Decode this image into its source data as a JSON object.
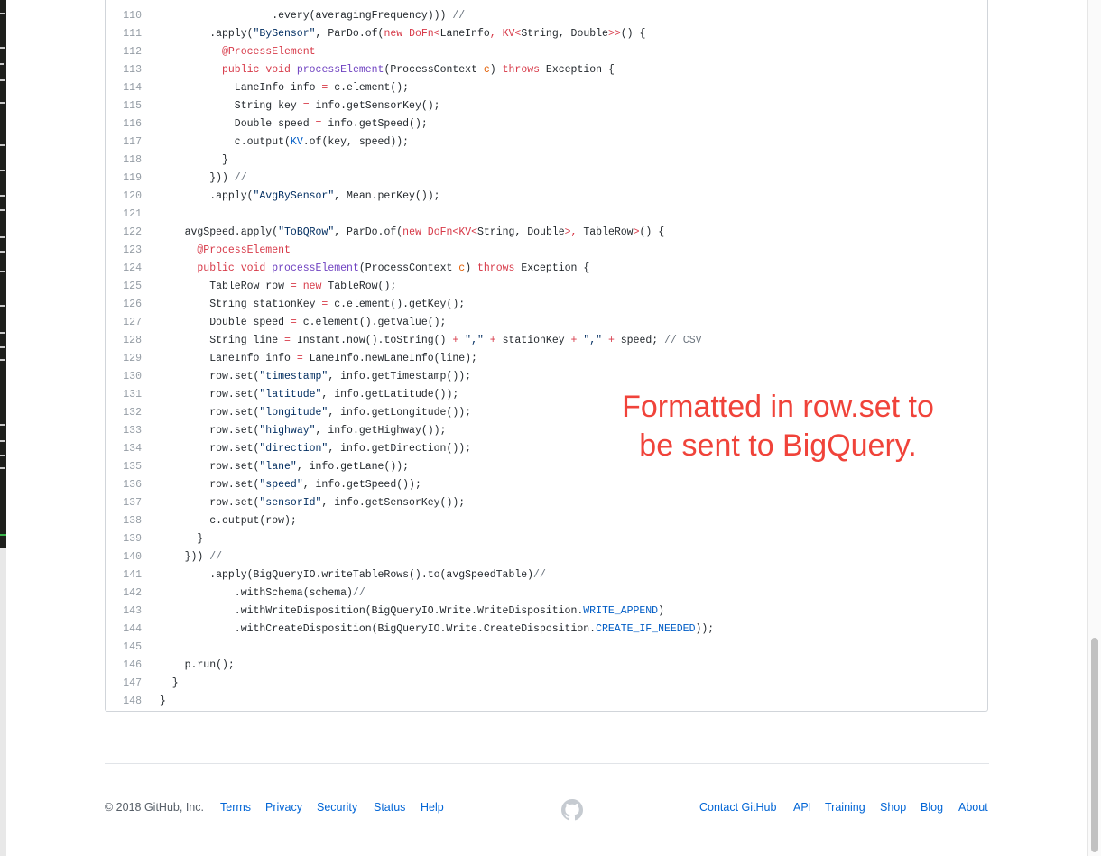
{
  "code_lines": [
    {
      "n": "110",
      "indent": 18,
      "tokens": [
        {
          "t": ".every(averagingFrequency))) "
        },
        {
          "t": "//",
          "c": "pl-c"
        }
      ]
    },
    {
      "n": "111",
      "indent": 8,
      "tokens": [
        {
          "t": ".apply("
        },
        {
          "t": "\"BySensor\"",
          "c": "pl-s"
        },
        {
          "t": ", ParDo.of("
        },
        {
          "t": "new",
          "c": "pl-k"
        },
        {
          "t": " "
        },
        {
          "t": "DoFn<",
          "c": "pl-k"
        },
        {
          "t": "LaneInfo"
        },
        {
          "t": ", ",
          "c": "pl-k"
        },
        {
          "t": "KV<",
          "c": "pl-k"
        },
        {
          "t": "String, Double"
        },
        {
          "t": ">>",
          "c": "pl-k"
        },
        {
          "t": "() {"
        }
      ]
    },
    {
      "n": "112",
      "indent": 10,
      "tokens": [
        {
          "t": "@ProcessElement",
          "c": "pl-k"
        }
      ]
    },
    {
      "n": "113",
      "indent": 10,
      "tokens": [
        {
          "t": "public",
          "c": "pl-k"
        },
        {
          "t": " "
        },
        {
          "t": "void",
          "c": "pl-k"
        },
        {
          "t": " "
        },
        {
          "t": "processElement",
          "c": "pl-en"
        },
        {
          "t": "(ProcessContext "
        },
        {
          "t": "c",
          "c": "pl-v"
        },
        {
          "t": ") "
        },
        {
          "t": "throws",
          "c": "pl-k"
        },
        {
          "t": " Exception {"
        }
      ]
    },
    {
      "n": "114",
      "indent": 12,
      "tokens": [
        {
          "t": "LaneInfo info "
        },
        {
          "t": "=",
          "c": "pl-k"
        },
        {
          "t": " c.element();"
        }
      ]
    },
    {
      "n": "115",
      "indent": 12,
      "tokens": [
        {
          "t": "String key "
        },
        {
          "t": "=",
          "c": "pl-k"
        },
        {
          "t": " info.getSensorKey();"
        }
      ]
    },
    {
      "n": "116",
      "indent": 12,
      "tokens": [
        {
          "t": "Double speed "
        },
        {
          "t": "=",
          "c": "pl-k"
        },
        {
          "t": " info.getSpeed();"
        }
      ]
    },
    {
      "n": "117",
      "indent": 12,
      "tokens": [
        {
          "t": "c.output("
        },
        {
          "t": "KV",
          "c": "pl-c1"
        },
        {
          "t": ".of(key, speed));"
        }
      ]
    },
    {
      "n": "118",
      "indent": 10,
      "tokens": [
        {
          "t": "}"
        }
      ]
    },
    {
      "n": "119",
      "indent": 8,
      "tokens": [
        {
          "t": "})) "
        },
        {
          "t": "//",
          "c": "pl-c"
        }
      ]
    },
    {
      "n": "120",
      "indent": 8,
      "tokens": [
        {
          "t": ".apply("
        },
        {
          "t": "\"AvgBySensor\"",
          "c": "pl-s"
        },
        {
          "t": ", Mean.perKey());"
        }
      ]
    },
    {
      "n": "121",
      "indent": 0,
      "tokens": []
    },
    {
      "n": "122",
      "indent": 4,
      "tokens": [
        {
          "t": "avgSpeed.apply("
        },
        {
          "t": "\"ToBQRow\"",
          "c": "pl-s"
        },
        {
          "t": ", ParDo.of("
        },
        {
          "t": "new",
          "c": "pl-k"
        },
        {
          "t": " "
        },
        {
          "t": "DoFn<",
          "c": "pl-k"
        },
        {
          "t": "KV<",
          "c": "pl-k"
        },
        {
          "t": "String, Double"
        },
        {
          "t": ">, ",
          "c": "pl-k"
        },
        {
          "t": "TableRow"
        },
        {
          "t": ">",
          "c": "pl-k"
        },
        {
          "t": "() {"
        }
      ]
    },
    {
      "n": "123",
      "indent": 6,
      "tokens": [
        {
          "t": "@ProcessElement",
          "c": "pl-k"
        }
      ]
    },
    {
      "n": "124",
      "indent": 6,
      "tokens": [
        {
          "t": "public",
          "c": "pl-k"
        },
        {
          "t": " "
        },
        {
          "t": "void",
          "c": "pl-k"
        },
        {
          "t": " "
        },
        {
          "t": "processElement",
          "c": "pl-en"
        },
        {
          "t": "(ProcessContext "
        },
        {
          "t": "c",
          "c": "pl-v"
        },
        {
          "t": ") "
        },
        {
          "t": "throws",
          "c": "pl-k"
        },
        {
          "t": " Exception {"
        }
      ]
    },
    {
      "n": "125",
      "indent": 8,
      "tokens": [
        {
          "t": "TableRow row "
        },
        {
          "t": "=",
          "c": "pl-k"
        },
        {
          "t": " "
        },
        {
          "t": "new",
          "c": "pl-k"
        },
        {
          "t": " TableRow();"
        }
      ]
    },
    {
      "n": "126",
      "indent": 8,
      "tokens": [
        {
          "t": "String stationKey "
        },
        {
          "t": "=",
          "c": "pl-k"
        },
        {
          "t": " c.element().getKey();"
        }
      ]
    },
    {
      "n": "127",
      "indent": 8,
      "tokens": [
        {
          "t": "Double speed "
        },
        {
          "t": "=",
          "c": "pl-k"
        },
        {
          "t": " c.element().getValue();"
        }
      ]
    },
    {
      "n": "128",
      "indent": 8,
      "tokens": [
        {
          "t": "String line "
        },
        {
          "t": "=",
          "c": "pl-k"
        },
        {
          "t": " Instant.now().toString() "
        },
        {
          "t": "+",
          "c": "pl-k"
        },
        {
          "t": " "
        },
        {
          "t": "\",\"",
          "c": "pl-s"
        },
        {
          "t": " "
        },
        {
          "t": "+",
          "c": "pl-k"
        },
        {
          "t": " stationKey "
        },
        {
          "t": "+",
          "c": "pl-k"
        },
        {
          "t": " "
        },
        {
          "t": "\",\"",
          "c": "pl-s"
        },
        {
          "t": " "
        },
        {
          "t": "+",
          "c": "pl-k"
        },
        {
          "t": " speed; "
        },
        {
          "t": "// CSV",
          "c": "pl-c"
        }
      ]
    },
    {
      "n": "129",
      "indent": 8,
      "tokens": [
        {
          "t": "LaneInfo info "
        },
        {
          "t": "=",
          "c": "pl-k"
        },
        {
          "t": " LaneInfo.newLaneInfo(line);"
        }
      ]
    },
    {
      "n": "130",
      "indent": 8,
      "tokens": [
        {
          "t": "row.set("
        },
        {
          "t": "\"timestamp\"",
          "c": "pl-s"
        },
        {
          "t": ", info.getTimestamp());"
        }
      ]
    },
    {
      "n": "131",
      "indent": 8,
      "tokens": [
        {
          "t": "row.set("
        },
        {
          "t": "\"latitude\"",
          "c": "pl-s"
        },
        {
          "t": ", info.getLatitude());"
        }
      ]
    },
    {
      "n": "132",
      "indent": 8,
      "tokens": [
        {
          "t": "row.set("
        },
        {
          "t": "\"longitude\"",
          "c": "pl-s"
        },
        {
          "t": ", info.getLongitude());"
        }
      ]
    },
    {
      "n": "133",
      "indent": 8,
      "tokens": [
        {
          "t": "row.set("
        },
        {
          "t": "\"highway\"",
          "c": "pl-s"
        },
        {
          "t": ", info.getHighway());"
        }
      ]
    },
    {
      "n": "134",
      "indent": 8,
      "tokens": [
        {
          "t": "row.set("
        },
        {
          "t": "\"direction\"",
          "c": "pl-s"
        },
        {
          "t": ", info.getDirection());"
        }
      ]
    },
    {
      "n": "135",
      "indent": 8,
      "tokens": [
        {
          "t": "row.set("
        },
        {
          "t": "\"lane\"",
          "c": "pl-s"
        },
        {
          "t": ", info.getLane());"
        }
      ]
    },
    {
      "n": "136",
      "indent": 8,
      "tokens": [
        {
          "t": "row.set("
        },
        {
          "t": "\"speed\"",
          "c": "pl-s"
        },
        {
          "t": ", info.getSpeed());"
        }
      ]
    },
    {
      "n": "137",
      "indent": 8,
      "tokens": [
        {
          "t": "row.set("
        },
        {
          "t": "\"sensorId\"",
          "c": "pl-s"
        },
        {
          "t": ", info.getSensorKey());"
        }
      ]
    },
    {
      "n": "138",
      "indent": 8,
      "tokens": [
        {
          "t": "c.output(row);"
        }
      ]
    },
    {
      "n": "139",
      "indent": 6,
      "tokens": [
        {
          "t": "}"
        }
      ]
    },
    {
      "n": "140",
      "indent": 4,
      "tokens": [
        {
          "t": "})) "
        },
        {
          "t": "//",
          "c": "pl-c"
        }
      ]
    },
    {
      "n": "141",
      "indent": 8,
      "tokens": [
        {
          "t": ".apply(BigQueryIO.writeTableRows().to(avgSpeedTable)"
        },
        {
          "t": "//",
          "c": "pl-c"
        }
      ]
    },
    {
      "n": "142",
      "indent": 12,
      "tokens": [
        {
          "t": ".withSchema(schema)"
        },
        {
          "t": "//",
          "c": "pl-c"
        }
      ]
    },
    {
      "n": "143",
      "indent": 12,
      "tokens": [
        {
          "t": ".withWriteDisposition(BigQueryIO.Write.WriteDisposition."
        },
        {
          "t": "WRITE_APPEND",
          "c": "pl-c1"
        },
        {
          "t": ")"
        }
      ]
    },
    {
      "n": "144",
      "indent": 12,
      "tokens": [
        {
          "t": ".withCreateDisposition(BigQueryIO.Write.CreateDisposition."
        },
        {
          "t": "CREATE_IF_NEEDED",
          "c": "pl-c1"
        },
        {
          "t": "));"
        }
      ]
    },
    {
      "n": "145",
      "indent": 0,
      "tokens": []
    },
    {
      "n": "146",
      "indent": 4,
      "tokens": [
        {
          "t": "p.run();"
        }
      ]
    },
    {
      "n": "147",
      "indent": 2,
      "tokens": [
        {
          "t": "}"
        }
      ]
    },
    {
      "n": "148",
      "indent": 0,
      "tokens": [
        {
          "t": "}"
        }
      ]
    }
  ],
  "annotation": {
    "line1": "Formatted in row.set to",
    "line2": "be sent to BigQuery."
  },
  "footer": {
    "copyright": "© 2018 GitHub, Inc.",
    "left_links": [
      "Terms",
      "Privacy",
      "Security",
      "Status",
      "Help"
    ],
    "right_links": [
      "Contact GitHub",
      "API",
      "Training",
      "Shop",
      "Blog",
      "About"
    ],
    "logo_icon": "github-octocat-icon"
  },
  "colors": {
    "keyword": "#d73a49",
    "entity": "#6f42c1",
    "string": "#032f62",
    "constant": "#005cc5",
    "comment": "#6a737d",
    "variable": "#e36209",
    "annotation_red": "#f0433a",
    "link_blue": "#0366d6"
  }
}
